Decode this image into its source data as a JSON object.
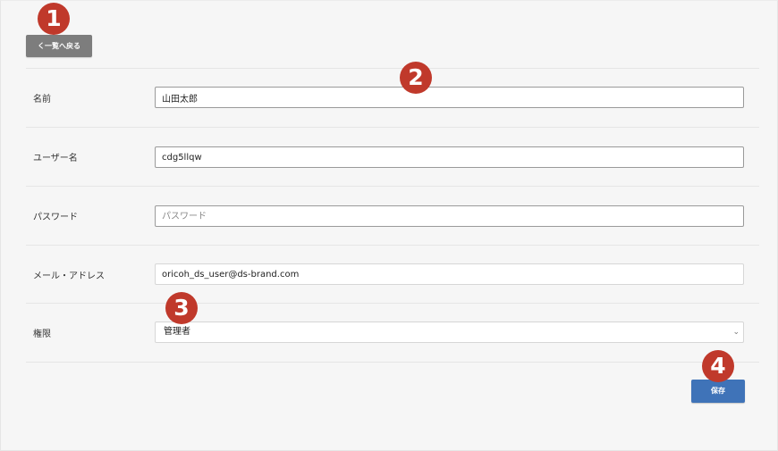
{
  "back_button": {
    "label": "く一覧へ戻る"
  },
  "form": {
    "fields": [
      {
        "label": "名前",
        "value": "山田太郎",
        "placeholder": ""
      },
      {
        "label": "ユーザー名",
        "value": "cdg5llqw",
        "placeholder": ""
      },
      {
        "label": "パスワード",
        "value": "",
        "placeholder": "パスワード"
      },
      {
        "label": "メール・アドレス",
        "value": "oricoh_ds_user@ds-brand.com",
        "placeholder": ""
      }
    ],
    "role": {
      "label": "権限",
      "selected": "管理者"
    }
  },
  "save_button": {
    "label": "保存"
  },
  "markers": [
    "1",
    "2",
    "3",
    "4"
  ],
  "colors": {
    "marker": "#c0392b",
    "save_button": "#3f73b8",
    "back_button": "#7d7d7d"
  }
}
